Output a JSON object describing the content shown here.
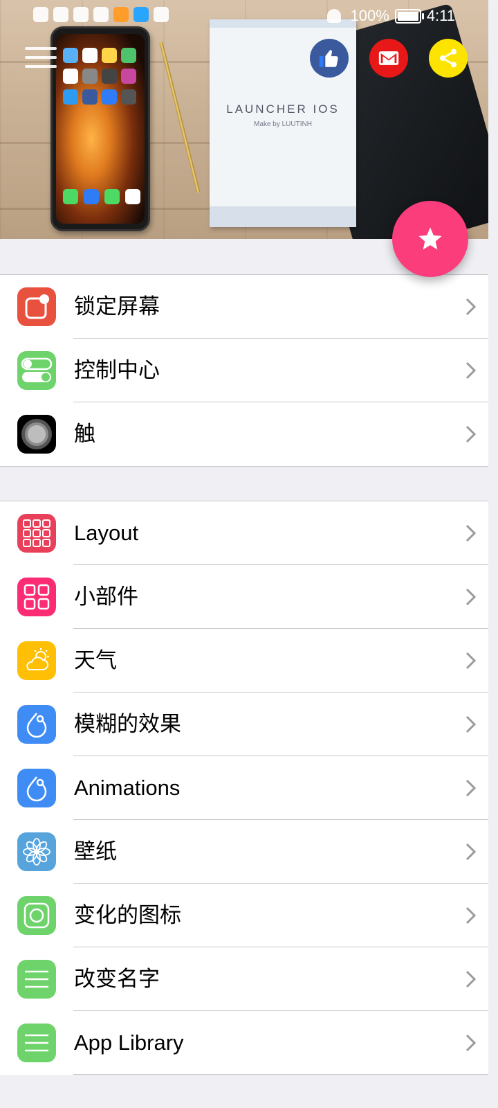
{
  "status_bar": {
    "battery": "100%",
    "time": "4:11"
  },
  "header": {
    "book_title": "LAUNCHER IOS",
    "book_subtitle": "Make by LUUTINH"
  },
  "groups": [
    {
      "items": [
        {
          "label": "锁定屏幕",
          "icon": "lock-screen-icon",
          "color": "#e9513f"
        },
        {
          "label": "控制中心",
          "icon": "toggle-icon",
          "color": "#6fd36c"
        },
        {
          "label": "触",
          "icon": "assistive-touch-icon",
          "color": "#000000"
        }
      ]
    },
    {
      "items": [
        {
          "label": "Layout",
          "icon": "grid-icon",
          "color": "#e8405a"
        },
        {
          "label": "小部件",
          "icon": "widgets-icon",
          "color": "#fb2c73"
        },
        {
          "label": "天气",
          "icon": "weather-icon",
          "color": "#ffbf05"
        },
        {
          "label": "模糊的效果",
          "icon": "blur-drop-icon",
          "color": "#3f8cf5"
        },
        {
          "label": "Animations",
          "icon": "animation-drop-icon",
          "color": "#3f8cf5"
        },
        {
          "label": "壁纸",
          "icon": "flower-icon",
          "color": "#57a3dc"
        },
        {
          "label": "变化的图标",
          "icon": "camera-frame-icon",
          "color": "#6fd36c"
        },
        {
          "label": "改变名字",
          "icon": "lines-icon",
          "color": "#6fd36c"
        },
        {
          "label": "App Library",
          "icon": "lines-icon",
          "color": "#6fd36c"
        }
      ]
    }
  ]
}
